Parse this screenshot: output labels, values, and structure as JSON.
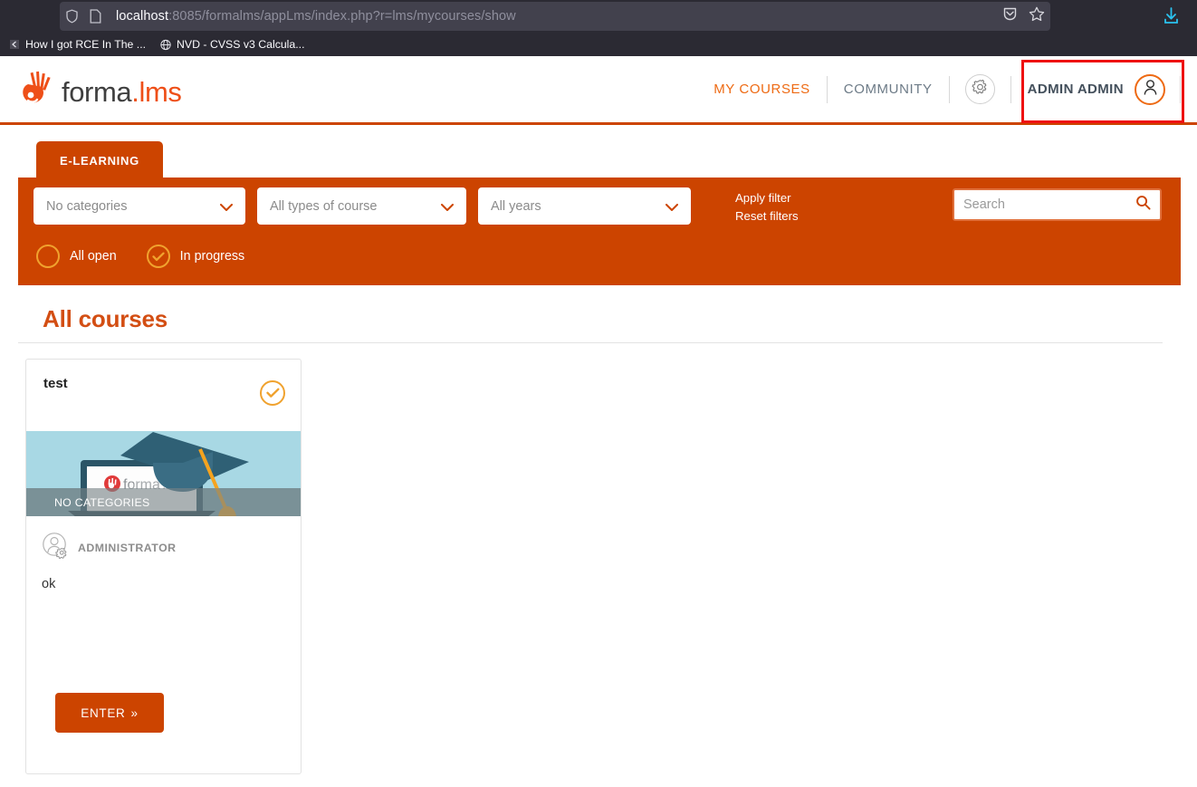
{
  "browser": {
    "url_host": "localhost",
    "url_path": ":8085/formalms/appLms/index.php?r=lms/mycourses/show",
    "shield_icon": "shield-icon",
    "page_icon": "page-icon",
    "save_icon": "save-to-pocket-icon",
    "bookmark_icon": "star-icon",
    "download_icon": "download-arrow-icon",
    "bookmarks": [
      {
        "label": "How I got RCE In The ...",
        "icon": "chevron-bookmark-icon"
      },
      {
        "label": "NVD - CVSS v3 Calcula...",
        "icon": "globe-icon"
      }
    ]
  },
  "header": {
    "logo_main": "forma",
    "logo_accent": ".lms",
    "logo_icon": "forma-hand-icon",
    "nav": [
      {
        "label": "MY COURSES",
        "state": "active"
      },
      {
        "label": "COMMUNITY",
        "state": "muted"
      }
    ],
    "gear_icon": "gear-icon",
    "user_name": "ADMIN ADMIN",
    "user_avatar_icon": "user-avatar-icon"
  },
  "filters": {
    "tab_label": "E-LEARNING",
    "selects": [
      {
        "value": "No categories"
      },
      {
        "value": "All types of course"
      },
      {
        "value": "All years"
      }
    ],
    "apply_label": "Apply filter",
    "reset_label": "Reset filters",
    "search_placeholder": "Search",
    "search_value": "",
    "search_icon": "search-icon",
    "radios": [
      {
        "label": "All open",
        "selected": false
      },
      {
        "label": "In progress",
        "selected": true
      }
    ]
  },
  "main": {
    "page_title": "All courses",
    "courses": [
      {
        "title": "test",
        "completed_icon": "check-circle-icon",
        "category": "NO CATEGORIES",
        "author": "ADMINISTRATOR",
        "author_icon": "admin-user-icon",
        "description": "ok",
        "enter_label": "ENTER",
        "enter_chevron": "»",
        "image_logo_text": "forma.lms"
      }
    ]
  },
  "colors": {
    "brand_orange": "#cc4400",
    "accent_orange": "#ee6a13",
    "amber": "#f0a22e",
    "title_orange": "#d34e13",
    "chrome_dark": "#2b2a33",
    "card_image_bg": "#a8d8e4",
    "download_blue": "#2ac3f0",
    "highlight_red": "#ee1111"
  }
}
